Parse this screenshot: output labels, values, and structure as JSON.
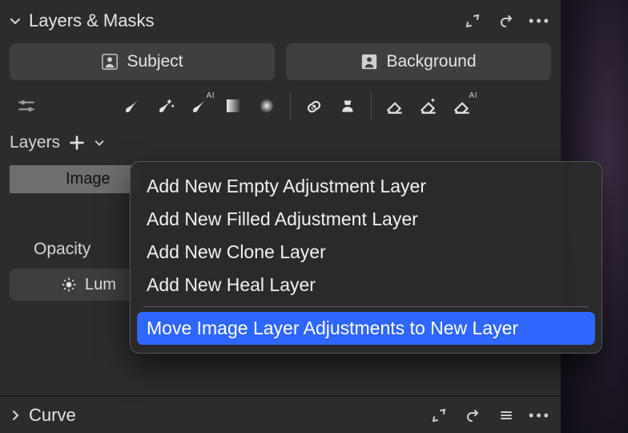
{
  "panels": {
    "layersMasks": {
      "title": "Layers & Masks"
    },
    "curve": {
      "title": "Curve"
    }
  },
  "segments": {
    "subject": "Subject",
    "background": "Background"
  },
  "tools": {
    "ai_label": "AI"
  },
  "layers": {
    "label": "Layers",
    "item0": "Image"
  },
  "opacity": {
    "label": "Opacity"
  },
  "luminosity": {
    "label_fragment": "Lum"
  },
  "menu": {
    "item1": "Add New Empty Adjustment Layer",
    "item2": "Add New Filled Adjustment Layer",
    "item3": "Add New Clone Layer",
    "item4": "Add New Heal Layer",
    "item5": "Move Image Layer Adjustments to New Layer"
  }
}
